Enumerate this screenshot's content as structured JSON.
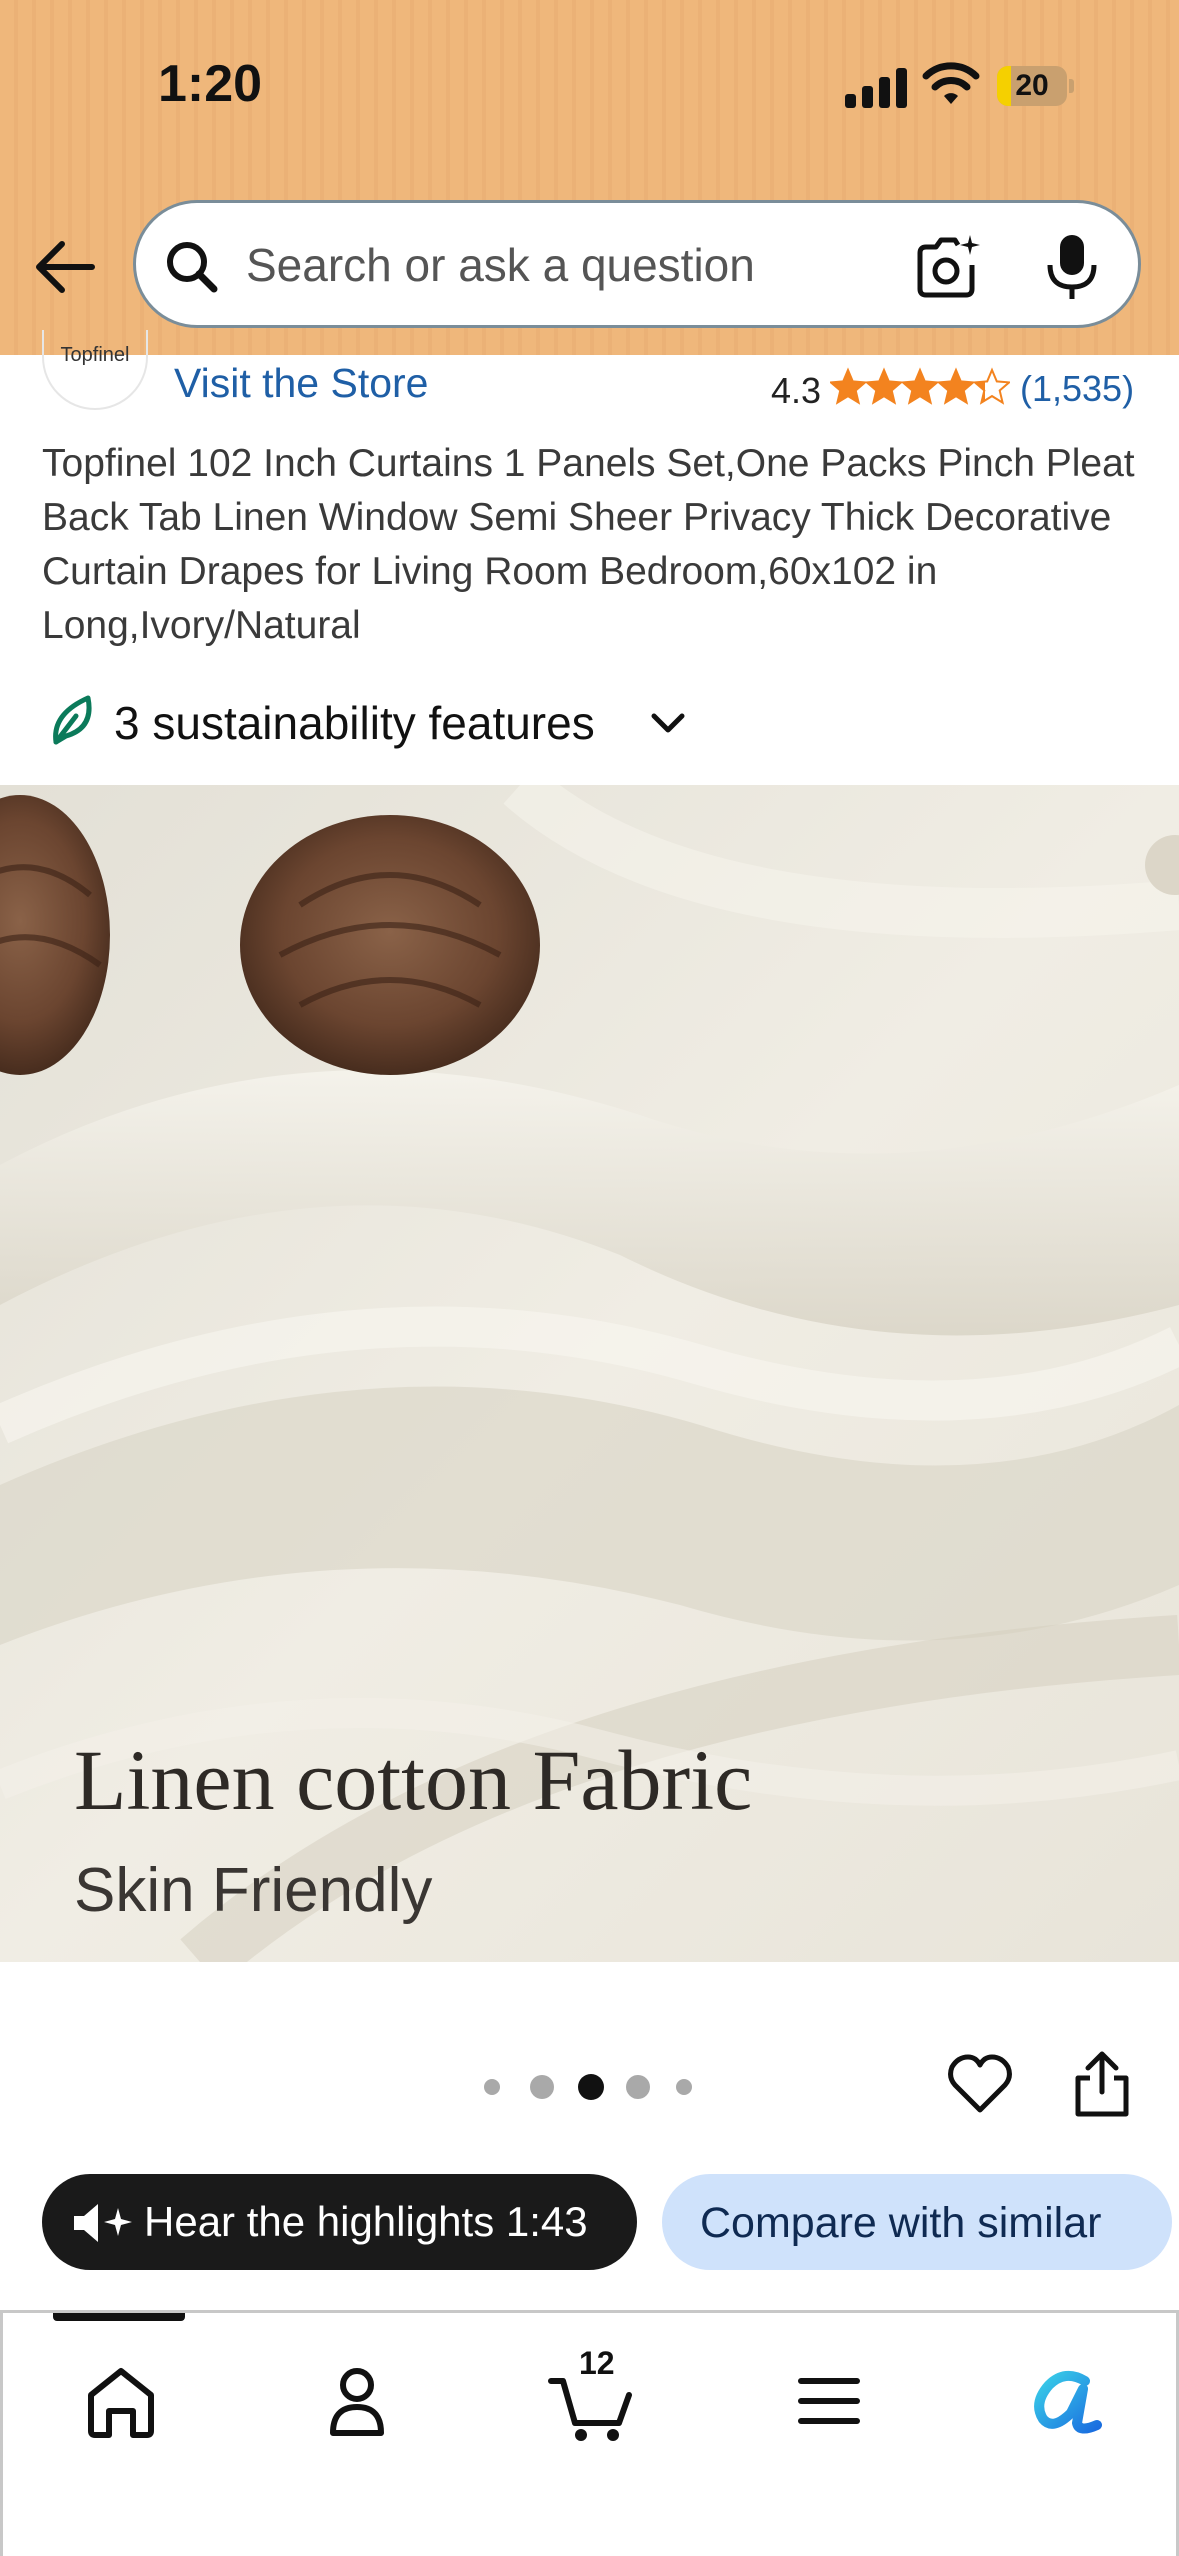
{
  "status_bar": {
    "time": "1:20",
    "battery_level": "20",
    "battery_fraction": 0.2,
    "battery_color": "#f5d000"
  },
  "header": {
    "background_color": "#efb77b",
    "back_icon": "arrow-left-icon",
    "search": {
      "placeholder": "Search or ask a question",
      "value": "",
      "icons": [
        "search-icon",
        "camera-scan-icon",
        "microphone-icon"
      ]
    }
  },
  "store": {
    "logo_text": "Topfinel",
    "visit_label": "Visit the Store",
    "rating": "4.3",
    "rating_value": 4.3,
    "rating_count": "(1,535)",
    "star_color": "#f3831f"
  },
  "product": {
    "title": "Topfinel 102 Inch Curtains 1 Panels Set,One Packs Pinch Pleat Back Tab Linen Window Semi Sheer Privacy Thick Decorative Curtain Drapes for Living Room Bedroom,60x102 in Long,Ivory/Natural",
    "sustainability_label": "3 sustainability features",
    "image": {
      "headline": "Linen cotton Fabric",
      "subline": "Skin Friendly"
    },
    "carousel": {
      "total": 5,
      "active_index": 2
    }
  },
  "actions": {
    "hear_label": "Hear the highlights 1:43",
    "compare_label": "Compare with similar"
  },
  "bottom_nav": {
    "items": [
      {
        "name": "home",
        "icon": "home-icon"
      },
      {
        "name": "account",
        "icon": "person-icon"
      },
      {
        "name": "cart",
        "icon": "cart-icon",
        "badge": "12"
      },
      {
        "name": "menu",
        "icon": "hamburger-menu-icon"
      },
      {
        "name": "rufus",
        "icon": "rufus-ai-icon"
      }
    ]
  }
}
